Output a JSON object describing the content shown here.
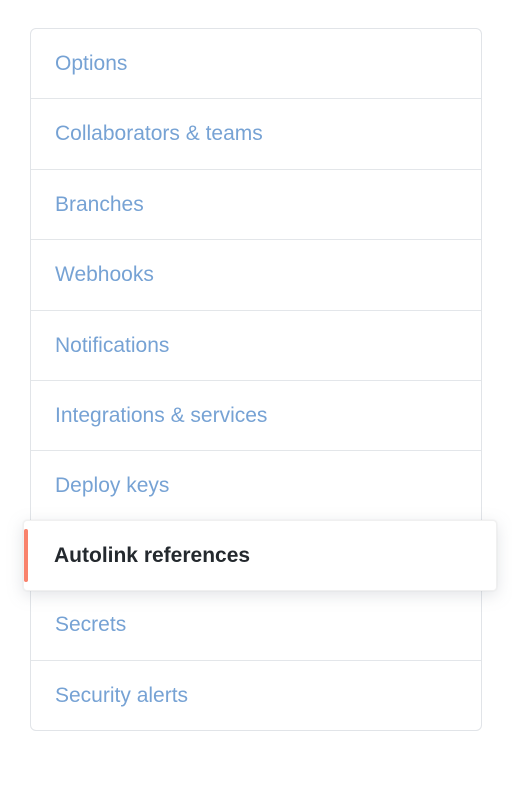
{
  "sidebar": {
    "items": [
      {
        "label": "Options",
        "active": false
      },
      {
        "label": "Collaborators & teams",
        "active": false
      },
      {
        "label": "Branches",
        "active": false
      },
      {
        "label": "Webhooks",
        "active": false
      },
      {
        "label": "Notifications",
        "active": false
      },
      {
        "label": "Integrations & services",
        "active": false
      },
      {
        "label": "Deploy keys",
        "active": false
      },
      {
        "label": "Autolink references",
        "active": true
      },
      {
        "label": "Secrets",
        "active": false
      },
      {
        "label": "Security alerts",
        "active": false
      }
    ]
  },
  "colors": {
    "link": "#6b9bd1",
    "active_text": "#24292e",
    "active_accent": "#f9826c",
    "border": "#e1e4e8"
  }
}
